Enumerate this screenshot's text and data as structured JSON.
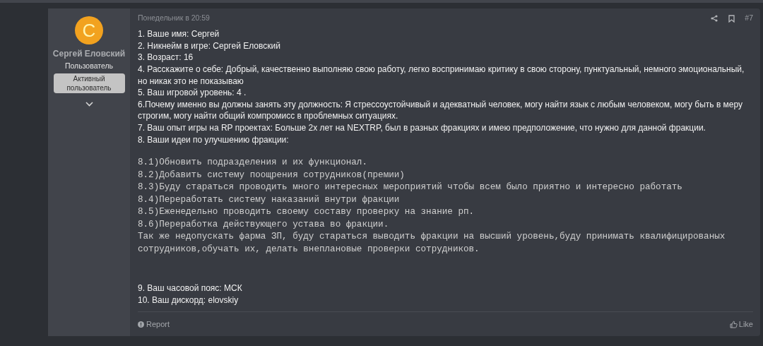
{
  "post": {
    "author": {
      "avatar_letter": "С",
      "name": "Сергей Еловский",
      "role": "Пользователь",
      "banner": "Активный пользователь"
    },
    "date": "Понедельник в 20:59",
    "post_number": "#7",
    "answers": [
      "1. Ваше имя: Сергей",
      "2. Никнейм в игре: Сергей Еловский",
      "3. Возраст: 16",
      "4. Расскажите о себе: Добрый, качественно выполняю свою работу, легко воспринимаю критику в свою сторону, пунктуальный, немного эмоциональный, но никак это не показываю",
      "5. Ваш игровой уровень: 4 .",
      "6.Почему именно вы должны занять эту должность: Я стрессоустойчивый и адекватный человек, могу найти язык с любым человеком, могу быть в меру строгим, могу найти общий компромисс в проблемных ситуациях.",
      "7. Ваш опыт игры на RP проектах: Больше 2х лет на NEXTRP, был в разных фракциях и имею предположение, что нужно для данной фракции.",
      "8. Ваши идеи по улучшению фракции:"
    ],
    "ideas": [
      "8.1)Обновить подразделения и их функционал.",
      "8.2)Добавить систему поощрения сотрудников(премии)",
      "8.3)Буду стараться проводить много интересных мероприятий чтобы всем было приятно и интересно работать",
      "8.4)Переработать систему наказаний внутри фракции",
      "8.5)Еженедельно проводить своему составу проверку на знание рп.",
      "8.6)Переработка действующего устава во фракции.",
      "Так же недопускать фарма ЗП, буду стараться выводить фракции на высший уровень,буду принимать квалифицированых сотрудников,обучать их, делать внеплановые проверки сотрудников."
    ],
    "closing": [
      "9. Ваш часовой пояс: МСК",
      "10. Ваш дискорд: elovskiy"
    ],
    "report": "Report",
    "like": "Like"
  }
}
